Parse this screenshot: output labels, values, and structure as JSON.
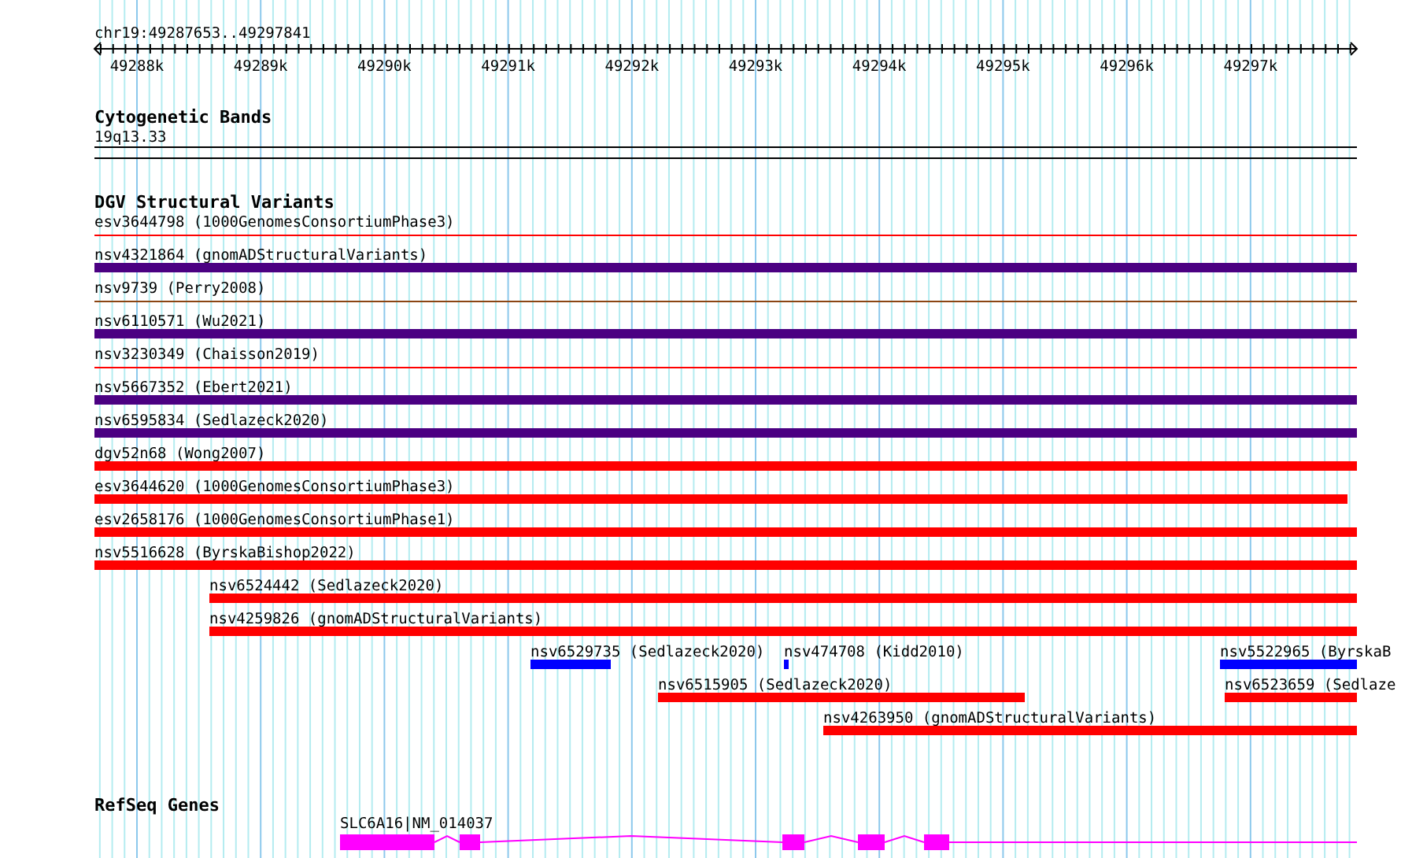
{
  "locus": "chr19:49287653..49297841",
  "ruler": {
    "ticks": [
      "49288k",
      "49289k",
      "49290k",
      "49291k",
      "49292k",
      "49293k",
      "49294k",
      "49295k",
      "49296k",
      "49297k"
    ]
  },
  "tracks": [
    {
      "kind": "bands",
      "title": "Cytogenetic Bands",
      "features": [
        {
          "label": "19q13.33"
        }
      ]
    },
    {
      "kind": "variants",
      "title": "DGV Structural Variants",
      "features": [
        {
          "label": "esv3644798 (1000GenomesConsortiumPhase3)",
          "color": "#ff0000",
          "kind": "line"
        },
        {
          "label": "nsv4321864 (gnomADStructuralVariants)",
          "color": "#4b0082",
          "kind": "bar"
        },
        {
          "label": "nsv9739 (Perry2008)",
          "color": "#8b4513",
          "kind": "line"
        },
        {
          "label": "nsv6110571 (Wu2021)",
          "color": "#4b0082",
          "kind": "bar"
        },
        {
          "label": "nsv3230349 (Chaisson2019)",
          "color": "#ff0000",
          "kind": "line"
        },
        {
          "label": "nsv5667352 (Ebert2021)",
          "color": "#4b0082",
          "kind": "bar"
        },
        {
          "label": "nsv6595834 (Sedlazeck2020)",
          "color": "#4b0082",
          "kind": "bar"
        },
        {
          "label": "dgv52n68 (Wong2007)",
          "color": "#ff0000",
          "kind": "bar"
        },
        {
          "label": "esv3644620 (1000GenomesConsortiumPhase3)",
          "color": "#ff0000",
          "kind": "bar"
        },
        {
          "label": "esv2658176 (1000GenomesConsortiumPhase1)",
          "color": "#ff0000",
          "kind": "bar"
        },
        {
          "label": "nsv5516628 (ByrskaBishop2022)",
          "color": "#ff0000",
          "kind": "bar"
        },
        {
          "label": "nsv6524442 (Sedlazeck2020)",
          "color": "#ff0000",
          "kind": "bar"
        },
        {
          "label": "nsv4259826 (gnomADStructuralVariants)",
          "color": "#ff0000",
          "kind": "bar"
        },
        {
          "label": "nsv6529735 (Sedlazeck2020)",
          "color": "#0000ff",
          "kind": "bar"
        },
        {
          "label": "nsv474708 (Kidd2010)",
          "color": "#0000ff",
          "kind": "bar"
        },
        {
          "label": "nsv5522965 (ByrskaB",
          "color": "#0000ff",
          "kind": "bar"
        },
        {
          "label": "nsv6515905 (Sedlazeck2020)",
          "color": "#ff0000",
          "kind": "bar"
        },
        {
          "label": "nsv6523659 (Sedlaze",
          "color": "#ff0000",
          "kind": "bar"
        },
        {
          "label": "nsv4263950 (gnomADStructuralVariants)",
          "color": "#ff0000",
          "kind": "bar"
        }
      ]
    },
    {
      "kind": "genes",
      "title": "RefSeq Genes",
      "features": [
        {
          "label": "SLC6A16|NM_014037"
        }
      ]
    }
  ]
}
